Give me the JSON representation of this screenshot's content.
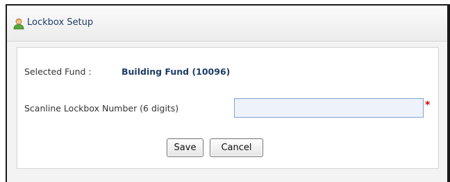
{
  "header": {
    "title": "Lockbox Setup",
    "icon": "user-icon"
  },
  "form": {
    "selected_fund_label": "Selected Fund :",
    "selected_fund_value": "Building Fund (10096)",
    "scanline_label": "Scanline Lockbox Number (6 digits)",
    "scanline_value": "",
    "required_marker": "*"
  },
  "buttons": {
    "save_label": "Save",
    "cancel_label": "Cancel"
  },
  "colors": {
    "title_text": "#1e3d66",
    "required": "#cc0000",
    "input_border": "#7fa3cf",
    "input_background": "#eef3fb"
  }
}
